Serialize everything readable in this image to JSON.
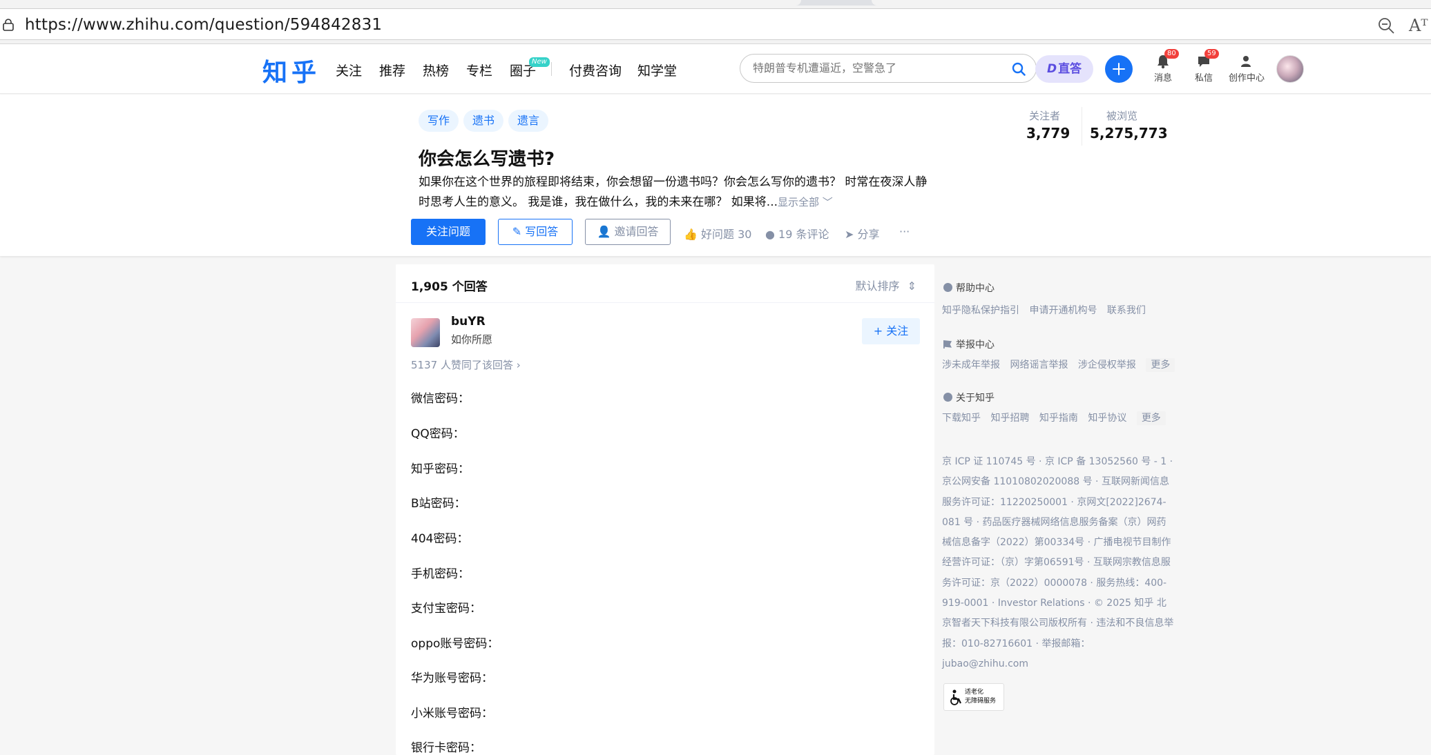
{
  "browser": {
    "url": "https://www.zhihu.com/question/594842831",
    "read_aloud": "Aᵀ"
  },
  "nav": {
    "logo": "知乎",
    "items": [
      "关注",
      "推荐",
      "热榜",
      "专栏",
      "圈子",
      "付费咨询",
      "知学堂"
    ],
    "new_badge": "New",
    "search_placeholder": "特朗普专机遭逼近，空警急了",
    "zhida_label": "直答",
    "zhida_glyph": "D",
    "messages_label": "消息",
    "messages_count": "80",
    "dm_label": "私信",
    "dm_count": "59",
    "creator_label": "创作中心"
  },
  "question": {
    "tags": [
      "写作",
      "遗书",
      "遗言"
    ],
    "title": "你会怎么写遗书?",
    "description": "如果你在这个世界的旅程即将结束，你会想留一份遗书吗？你会怎么写你的遗书？ 时常在夜深人静时思考人生的意义。 我是谁，我在做什么，我的未来在哪？ 如果将...",
    "show_all": "显示全部 ﹀",
    "followers_label": "关注者",
    "followers_value": "3,779",
    "views_label": "被浏览",
    "views_value": "5,275,773",
    "follow_button": "关注问题",
    "write_button": "写回答",
    "invite_button": "邀请回答",
    "good_question": "好问题 30",
    "comments": "19 条评论",
    "share": "分享",
    "more": "···"
  },
  "answers": {
    "count_label": "1,905 个回答",
    "sort_label": "默认排序",
    "author_name": "buYR",
    "author_bio": "如你所愿",
    "follow_label": "+ 关注",
    "votes_label": "5137 人赞同了该回答 ›",
    "lines": [
      "微信密码：",
      "QQ密码：",
      "知乎密码：",
      "B站密码：",
      "404密码：",
      "手机密码：",
      "支付宝密码：",
      "oppo账号密码：",
      "华为账号密码：",
      "小米账号密码：",
      "银行卡密码："
    ]
  },
  "sidebar": {
    "help_title": "帮助中心",
    "help_links": [
      "知乎隐私保护指引",
      "申请开通机构号",
      "联系我们"
    ],
    "report_title": "举报中心",
    "report_links": [
      "涉未成年举报",
      "网络谣言举报",
      "涉企侵权举报"
    ],
    "about_title": "关于知乎",
    "about_links": [
      "下载知乎",
      "知乎招聘",
      "知乎指南",
      "知乎协议"
    ],
    "more_label": "更多",
    "legal_text": "京 ICP 证 110745 号 · 京 ICP 备 13052560 号 - 1 · 京公网安备 11010802020088 号 · 互联网新闻信息服务许可证：11220250001 · 京网文[2022]2674-081 号 · 药品医疗器械网络信息服务备案（京）网药械信息备字（2022）第00334号 · 广播电视节目制作经营许可证：（京）字第06591号 · 互联网宗教信息服务许可证：京（2022）0000078 · 服务热线：400-919-0001 · Investor Relations · © 2025 知乎 北京智者天下科技有限公司版权所有 · 违法和不良信息举报：010-82716601 · 举报邮箱：jubao@zhihu.com",
    "elder_badge_line1": "适老化",
    "elder_badge_line2": "无障碍服务"
  },
  "colors": {
    "brand_blue": "#1772f6",
    "muted": "#8590a6",
    "badge_red": "#f1403c"
  }
}
